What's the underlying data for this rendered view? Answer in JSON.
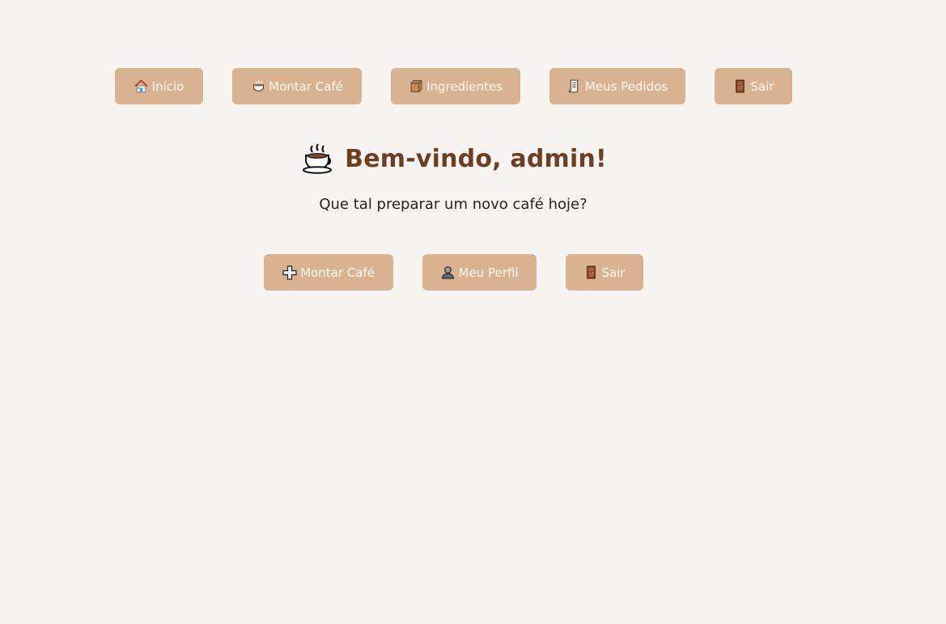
{
  "nav": {
    "items": [
      {
        "label": "Início",
        "icon": "house-icon"
      },
      {
        "label": "Montar Café",
        "icon": "coffee-cup-icon"
      },
      {
        "label": "Ingredientes",
        "icon": "box-icon"
      },
      {
        "label": "Meus Pedidos",
        "icon": "receipt-icon"
      },
      {
        "label": "Sair",
        "icon": "door-icon"
      }
    ]
  },
  "welcome": {
    "title": "Bem-vindo, admin!",
    "subtitle": "Que tal preparar um novo café hoje?",
    "icon": "hot-coffee-icon"
  },
  "actions": {
    "items": [
      {
        "label": "Montar Café",
        "icon": "plus-icon"
      },
      {
        "label": "Meu Perfil",
        "icon": "user-icon"
      },
      {
        "label": "Sair",
        "icon": "door-icon"
      }
    ]
  },
  "colors": {
    "background": "#f7f3f0",
    "button": "#d9b391",
    "button_text": "#fffaf4",
    "title": "#6a3f24",
    "subtitle": "#2a211b"
  }
}
